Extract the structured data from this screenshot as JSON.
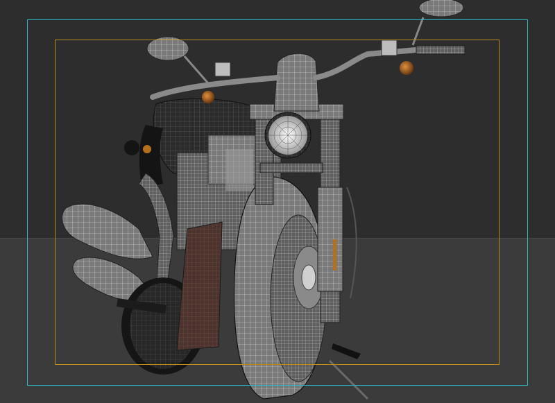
{
  "viewport": {
    "background_colors": [
      "#2d2d2d",
      "#3b3b3b"
    ],
    "mesh_color": "#d8d8d8",
    "accent_colors": {
      "outer_safe_frame": "#2fb7bf",
      "inner_safe_frame": "#b98a20",
      "turn_signal": "#b5701e",
      "footboard": "#5a3a32"
    }
  },
  "model": {
    "icon": "motorcycle-wireframe-icon"
  }
}
